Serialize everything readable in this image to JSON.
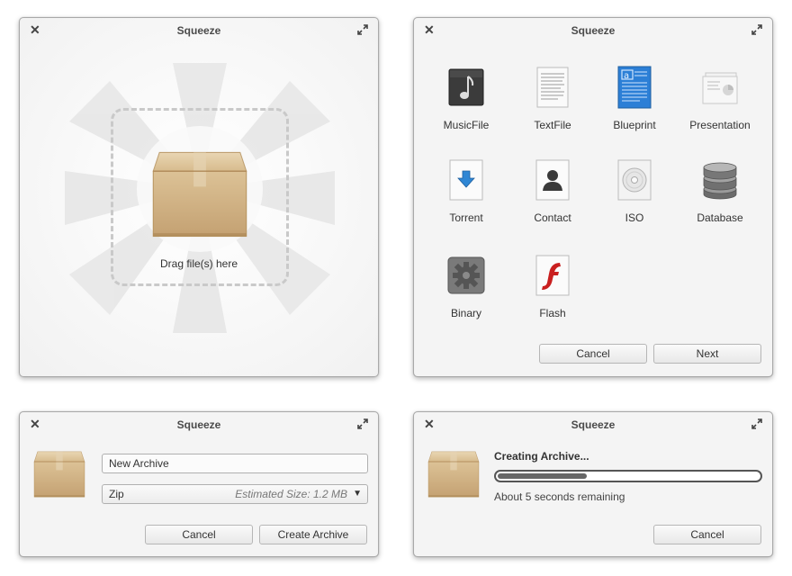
{
  "app_title": "Squeeze",
  "drop_window": {
    "label": "Drag file(s) here"
  },
  "type_window": {
    "types": [
      {
        "label": "MusicFile",
        "icon": "music-file-icon"
      },
      {
        "label": "TextFile",
        "icon": "text-file-icon"
      },
      {
        "label": "Blueprint",
        "icon": "blueprint-icon"
      },
      {
        "label": "Presentation",
        "icon": "presentation-icon"
      },
      {
        "label": "Torrent",
        "icon": "torrent-icon"
      },
      {
        "label": "Contact",
        "icon": "contact-icon"
      },
      {
        "label": "ISO",
        "icon": "iso-disc-icon"
      },
      {
        "label": "Database",
        "icon": "database-icon"
      },
      {
        "label": "Binary",
        "icon": "binary-gear-icon"
      },
      {
        "label": "Flash",
        "icon": "flash-icon"
      }
    ],
    "cancel_label": "Cancel",
    "next_label": "Next"
  },
  "create_window": {
    "name_value": "New Archive",
    "format_value": "Zip",
    "estimated_size": "Estimated Size: 1.2 MB",
    "cancel_label": "Cancel",
    "create_label": "Create Archive"
  },
  "progress_window": {
    "title": "Creating Archive...",
    "progress": 0.35,
    "remaining": "About 5 seconds remaining",
    "cancel_label": "Cancel"
  },
  "colors": {
    "box_light": "#d8bb8c",
    "box_dark": "#b89462",
    "blueprint": "#2c7fd6",
    "torrent": "#2f86d4",
    "flash": "#c91f1f"
  }
}
